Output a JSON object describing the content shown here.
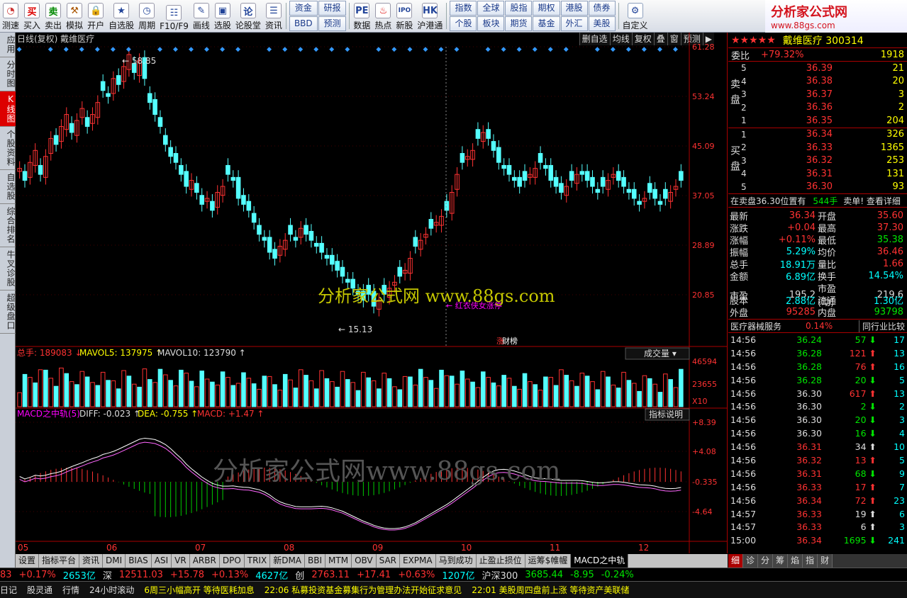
{
  "toolbar": {
    "buttons": [
      {
        "label": "测速",
        "icon": "clock-icon",
        "color": "#c33"
      },
      {
        "label": "买入",
        "icon": "buy-icon",
        "glyph": "买",
        "color": "#d00"
      },
      {
        "label": "卖出",
        "icon": "sell-icon",
        "glyph": "卖",
        "color": "#080"
      },
      {
        "label": "模拟",
        "icon": "hammer-icon",
        "glyph": "⚒",
        "color": "#a50"
      },
      {
        "label": "开户",
        "icon": "lock-icon",
        "glyph": "🔒",
        "color": "#666"
      },
      {
        "label": "自选股",
        "icon": "star-icon",
        "glyph": "★",
        "color": "#249"
      },
      {
        "label": "周期",
        "icon": "cycle-icon",
        "glyph": "◷",
        "color": "#249"
      },
      {
        "label": "F10/F9",
        "icon": "grid-icon",
        "glyph": "☷",
        "color": "#249"
      },
      {
        "label": "画线",
        "icon": "pen-icon",
        "glyph": "✎",
        "color": "#249"
      },
      {
        "label": "选股",
        "icon": "screen-icon",
        "glyph": "▣",
        "color": "#249"
      },
      {
        "label": "论股堂",
        "icon": "forum-icon",
        "glyph": "论",
        "color": "#249"
      },
      {
        "label": "资讯",
        "icon": "doc-icon",
        "glyph": "☰",
        "color": "#249"
      }
    ],
    "grid1": [
      "资金",
      "研报",
      "BBD",
      "预测"
    ],
    "buttons2": [
      {
        "label": "数据",
        "icon": "pe-icon",
        "glyph": "PE",
        "color": "#249"
      },
      {
        "label": "热点",
        "icon": "hot-icon",
        "glyph": "♨",
        "color": "#d00"
      },
      {
        "label": "新股",
        "icon": "ipo-icon",
        "glyph": "IPO",
        "color": "#249"
      },
      {
        "label": "沪港通",
        "icon": "hk-icon",
        "glyph": "HK",
        "color": "#249"
      }
    ],
    "grid2": [
      "指数",
      "全球",
      "股指",
      "期权",
      "港股",
      "债券",
      "个股",
      "板块",
      "期货",
      "基金",
      "外汇",
      "美股"
    ],
    "custom": {
      "label": "自定义",
      "icon": "custom-icon",
      "glyph": "⚙"
    }
  },
  "logo": {
    "title": "分析家公式网",
    "url": "www.88gs.com"
  },
  "left_tabs": [
    {
      "label": "应用",
      "active": false
    },
    {
      "label": "分时图",
      "active": false
    },
    {
      "label": "K线图",
      "active": true
    },
    {
      "label": "个股资料",
      "active": false
    },
    {
      "label": "自选股",
      "active": false
    },
    {
      "label": "综合排名",
      "active": false
    },
    {
      "label": "牛叉诊股",
      "active": false
    },
    {
      "label": "超级盘口",
      "active": false
    }
  ],
  "chart": {
    "header": "日线(复权)  戴维医疗",
    "buttons": [
      "删自选",
      "均线",
      "复权",
      "叠",
      "窗",
      "预测",
      "▶"
    ],
    "price_axis": [
      "61.28",
      "53.24",
      "45.09",
      "37.05",
      "28.89",
      "20.85"
    ],
    "high_label": "58.85",
    "low_label": "15.13",
    "annotation": "← 红衣侠女涨停",
    "badges": [
      "涨",
      "财榜"
    ],
    "watermark_main": "分析家公式网 www.88gs.com",
    "watermark_macd": "分析家公式网www.88gs.com",
    "volume_header": {
      "total": "总手: 189083",
      "ma5": "MAVOL5: 137975",
      "ma10": "MAVOL10: 123790",
      "selector": "成交量"
    },
    "volume_axis": [
      "46594",
      "23655",
      "X10"
    ],
    "macd_header": {
      "name": "MACD之中轨(5)",
      "diff": "DIFF: -0.023",
      "dea": "DEA: -0.755",
      "macd": "MACD: +1.47",
      "help": "指标说明"
    },
    "macd_axis": [
      "+8.39",
      "+4.08",
      "-0.335",
      "-4.64"
    ],
    "months": [
      "05",
      "06",
      "07",
      "08",
      "09",
      "10",
      "11",
      "12"
    ]
  },
  "chart_data": {
    "type": "candlestick",
    "ylim": [
      12,
      62
    ],
    "colors": {
      "up": "#ff3232",
      "down": "#54ffff",
      "ma": "#ffffff",
      "diff": "#ffffff",
      "dea": "#ff66ff"
    },
    "close": [
      39,
      37,
      40,
      42,
      38,
      41,
      44,
      43,
      46,
      48,
      45,
      47,
      49,
      46,
      48,
      50,
      52,
      51,
      54,
      53,
      56,
      58,
      55,
      57,
      54,
      50,
      48,
      46,
      43,
      41,
      40,
      38,
      36,
      37,
      35,
      33,
      34,
      32,
      35,
      36,
      38,
      37,
      34,
      33,
      32,
      30,
      28,
      27,
      25,
      24,
      26,
      27,
      28,
      27,
      29,
      28,
      27,
      26,
      25,
      24,
      23,
      22,
      21,
      20,
      19,
      18,
      17,
      18,
      16,
      17,
      18,
      19,
      20,
      21,
      22,
      24,
      26,
      27,
      28,
      29,
      30,
      31,
      32,
      35,
      38,
      40,
      41,
      42,
      44,
      45,
      44,
      42,
      40,
      39,
      38,
      37,
      36,
      37,
      38,
      39,
      40,
      39,
      37,
      36,
      35,
      36,
      37,
      38,
      38,
      37,
      36,
      35,
      36,
      37,
      38,
      37,
      36,
      35,
      34,
      33,
      34,
      35,
      34,
      33,
      34,
      35,
      36,
      37
    ]
  }
}
